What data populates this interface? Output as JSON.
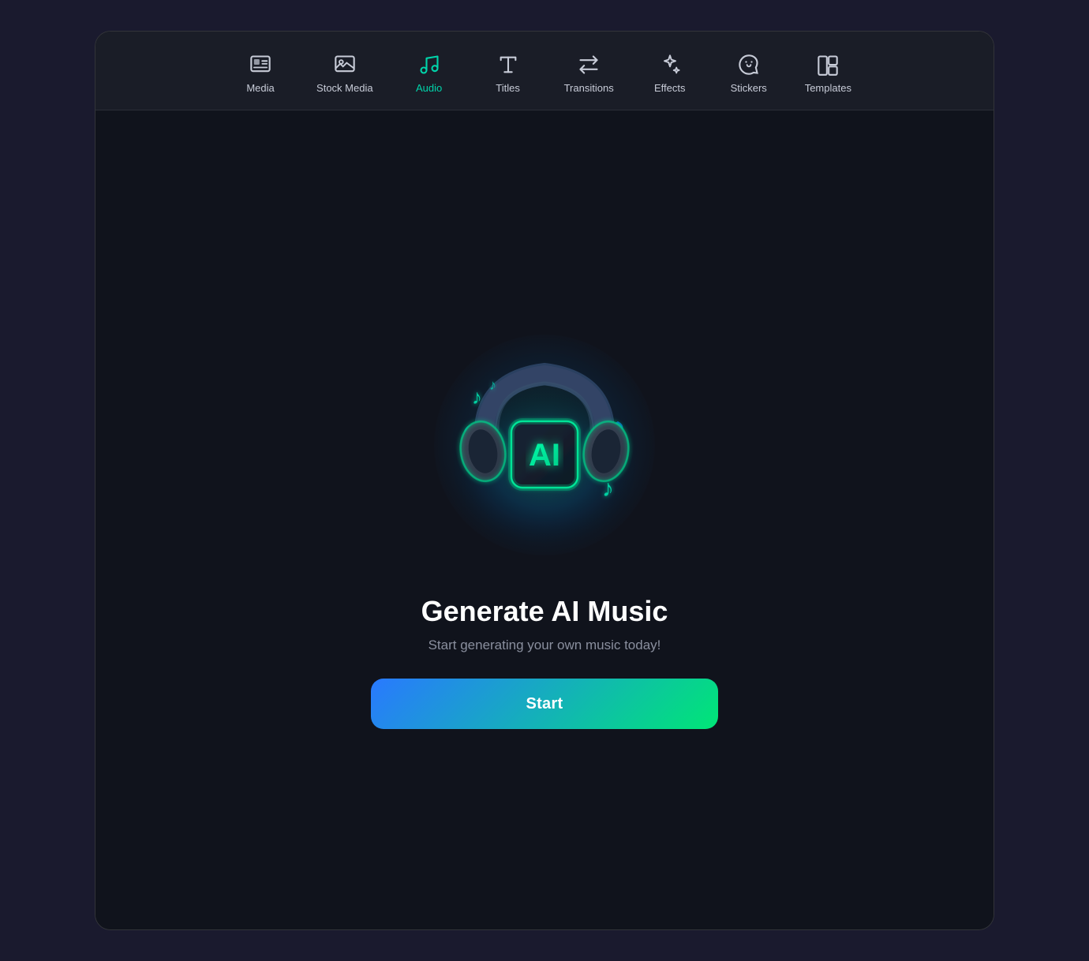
{
  "toolbar": {
    "items": [
      {
        "id": "media",
        "label": "Media",
        "active": false
      },
      {
        "id": "stock-media",
        "label": "Stock Media",
        "active": false
      },
      {
        "id": "audio",
        "label": "Audio",
        "active": true
      },
      {
        "id": "titles",
        "label": "Titles",
        "active": false
      },
      {
        "id": "transitions",
        "label": "Transitions",
        "active": false
      },
      {
        "id": "effects",
        "label": "Effects",
        "active": false
      },
      {
        "id": "stickers",
        "label": "Stickers",
        "active": false
      },
      {
        "id": "templates",
        "label": "Templates",
        "active": false
      }
    ]
  },
  "main": {
    "title": "Generate AI Music",
    "subtitle": "Start generating your own music today!",
    "start_button": "Start"
  },
  "colors": {
    "active": "#00d4aa",
    "inactive": "#c8ccd8",
    "background": "#10131c",
    "toolbar_bg": "#1a1d27",
    "button_gradient_start": "#2979ff",
    "button_gradient_end": "#00e676"
  }
}
